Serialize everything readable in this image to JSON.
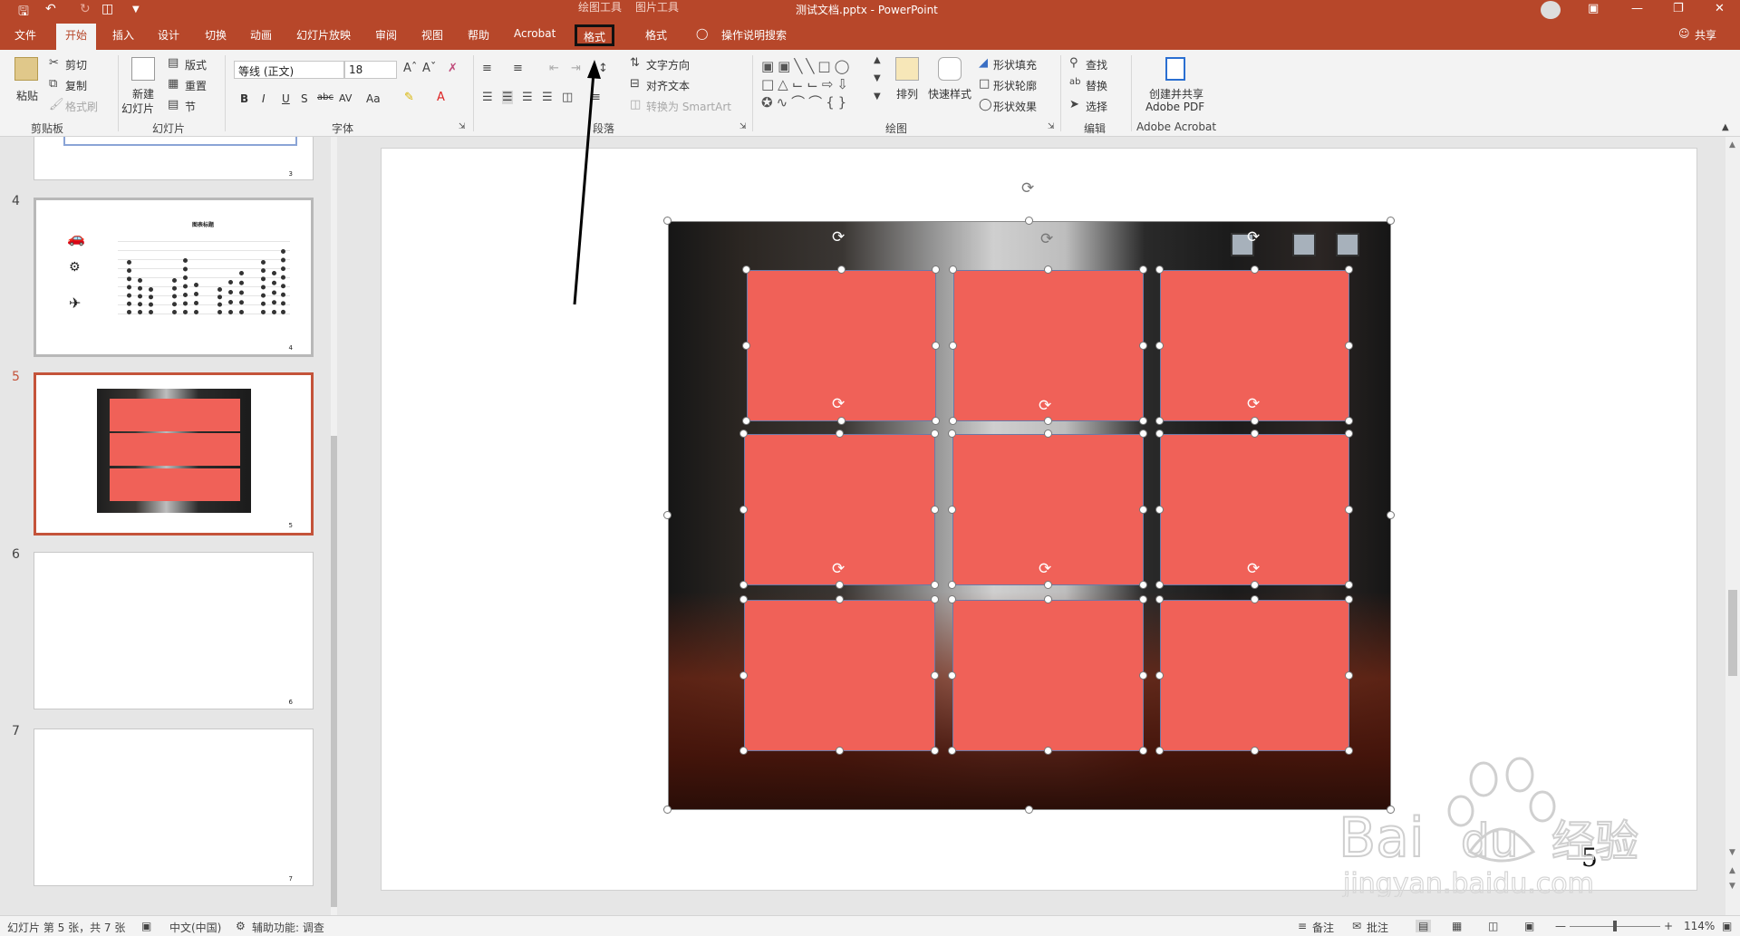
{
  "window": {
    "doc_title": "测试文档.pptx  -  PowerPoint",
    "context_tab_drawing": "绘图工具",
    "context_tab_picture": "图片工具"
  },
  "tabs": [
    "文件",
    "开始",
    "插入",
    "设计",
    "切换",
    "动画",
    "幻灯片放映",
    "审阅",
    "视图",
    "帮助",
    "Acrobat",
    "格式",
    "格式"
  ],
  "tell_me": "操作说明搜索",
  "share": "共享",
  "ribbon": {
    "clipboard": {
      "paste": "粘贴",
      "cut": "剪切",
      "copy": "复制",
      "format_painter": "格式刷",
      "label": "剪贴板"
    },
    "slides": {
      "new_slide_1": "新建",
      "new_slide_2": "幻灯片",
      "layout": "版式",
      "reset": "重置",
      "section": "节",
      "label": "幻灯片"
    },
    "font": {
      "name": "等线 (正文)",
      "size": "18",
      "label": "字体",
      "bold": "B",
      "italic": "I",
      "underline": "U",
      "shadow": "S",
      "strike": "abc",
      "spacing": "AV",
      "case": "Aa"
    },
    "paragraph": {
      "text_direction": "文字方向",
      "align_text": "对齐文本",
      "convert_smartart": "转换为 SmartArt",
      "label": "段落"
    },
    "drawing": {
      "arrange": "排列",
      "quick_styles": "快速样式",
      "shape_fill": "形状填充",
      "shape_outline": "形状轮廓",
      "shape_effects": "形状效果",
      "label": "绘图"
    },
    "editing": {
      "find": "查找",
      "replace": "替换",
      "select": "选择",
      "label": "编辑"
    },
    "acrobat": {
      "create_1": "创建并共享",
      "create_2": "Adobe PDF",
      "label": "Adobe Acrobat"
    }
  },
  "thumbnails": [
    {
      "num": "",
      "page": "3"
    },
    {
      "num": "4",
      "page": "4",
      "title": "图表标题"
    },
    {
      "num": "5",
      "page": "5"
    },
    {
      "num": "6",
      "page": "6"
    },
    {
      "num": "7",
      "page": "7"
    }
  ],
  "slide": {
    "page_number": "5"
  },
  "status": {
    "slide_info": "幻灯片 第 5 张，共 7 张",
    "language": "中文(中国)",
    "accessibility": "辅助功能: 调查",
    "notes": "备注",
    "comments": "批注",
    "zoom": "114%"
  },
  "watermark": {
    "text1": "Bai",
    "text2": "du",
    "text3": "经验",
    "url": "jingyan.baidu.com"
  },
  "colors": {
    "accent": "#b7472a",
    "shape_fill": "#f06158",
    "selection": "#c4533a"
  }
}
